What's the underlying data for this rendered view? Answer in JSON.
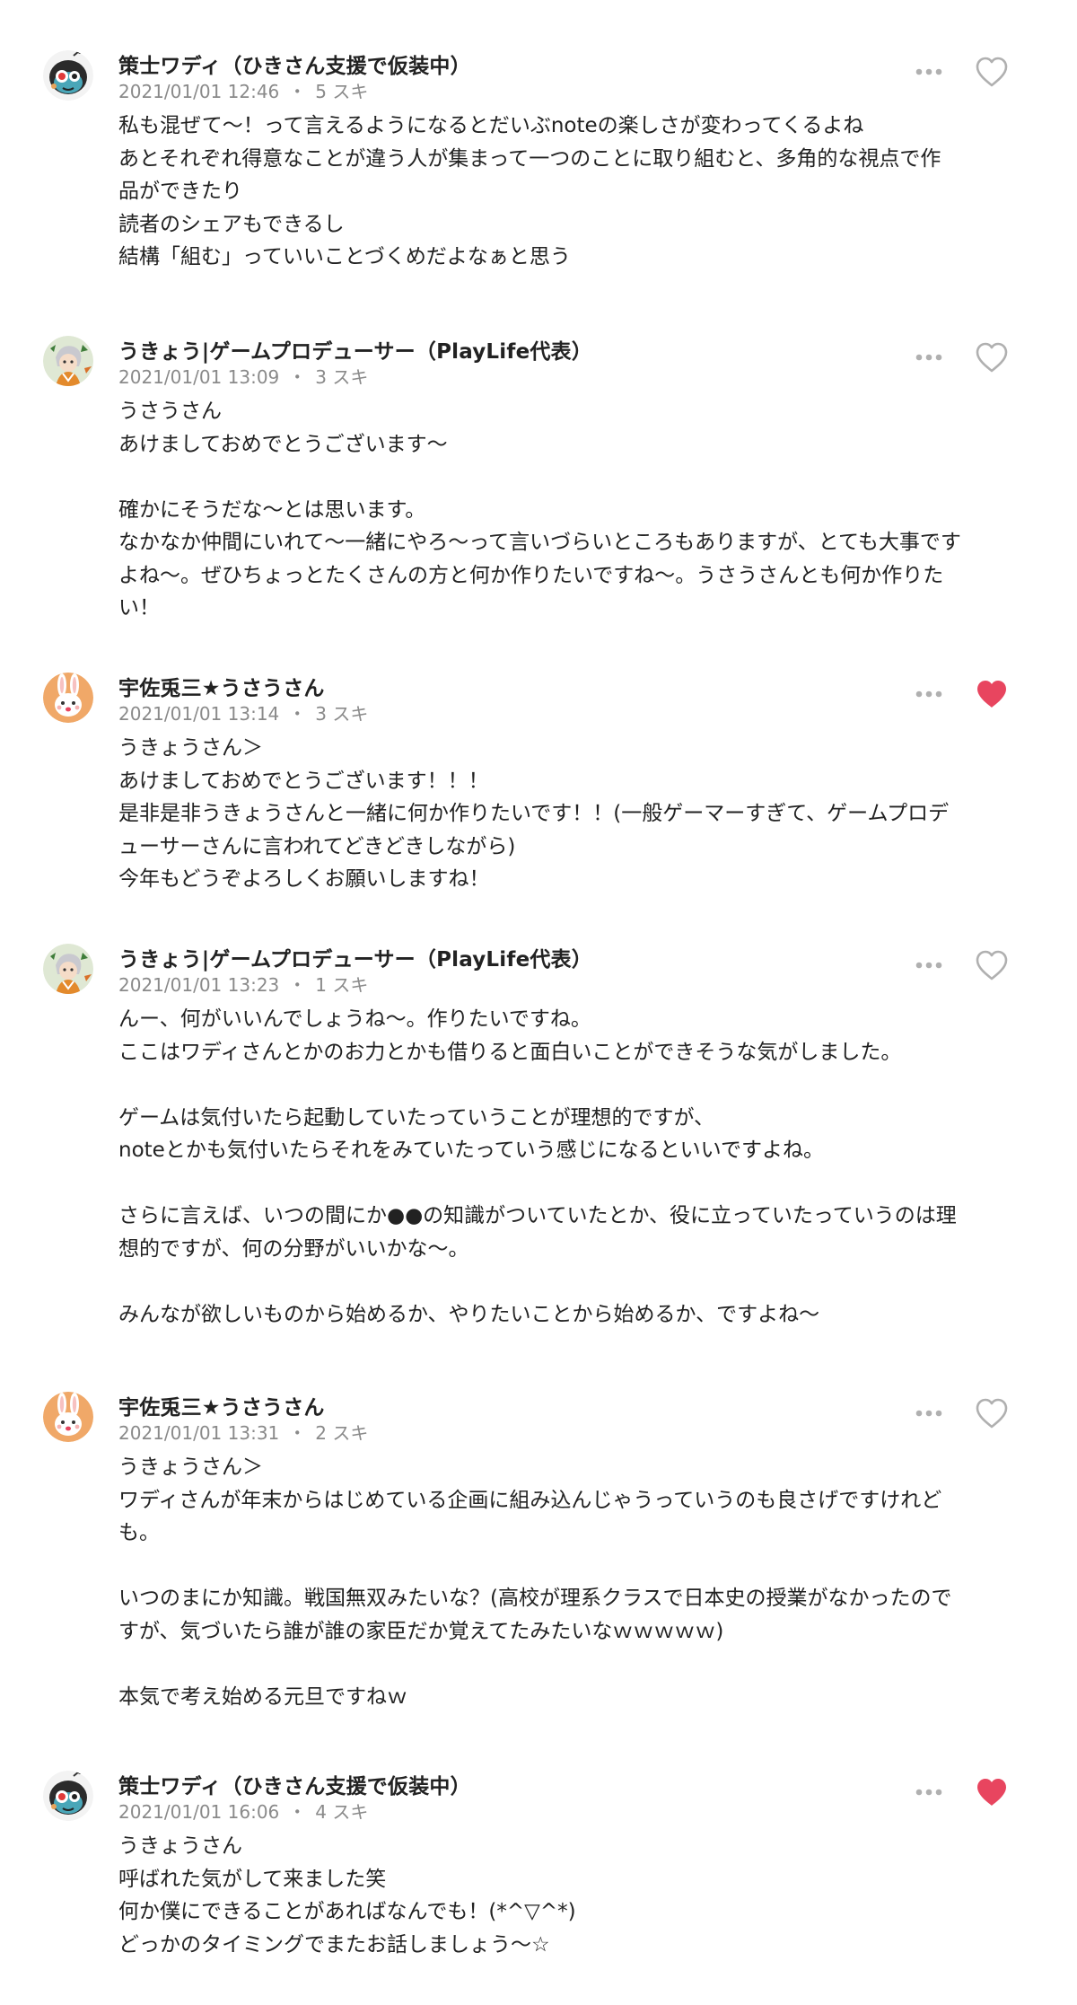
{
  "comments": [
    {
      "author": "策士ワディ（ひきさん支援で仮装中）",
      "date": "2021/01/01 12:46",
      "likes": "5 スキ",
      "liked": false,
      "avatar_icon": "robot-avatar-icon",
      "lines": [
        "私も混ぜて〜！って言えるようになるとだいぶnoteの楽しさが変わってくるよね",
        "あとそれぞれ得意なことが違う人が集まって一つのことに取り組むと、多角的な視点で作",
        "品ができたり",
        "読者のシェアもできるし",
        "結構「組む」っていいことづくめだよなぁと思う"
      ]
    },
    {
      "author": "うきょう|ゲームプロデューサー（PlayLife代表）",
      "date": "2021/01/01 13:09",
      "likes": "3 スキ",
      "liked": false,
      "avatar_icon": "character-avatar-icon",
      "lines": [
        "うさうさん",
        "あけましておめでとうございます〜",
        "",
        "確かにそうだな〜とは思います。",
        "なかなか仲間にいれて〜一緒にやろ〜って言いづらいところもありますが、とても大事です",
        "よね〜。ぜひちょっとたくさんの方と何か作りたいですね〜。うさうさんとも何か作りた",
        "い！"
      ]
    },
    {
      "author": "宇佐兎三★うさうさん",
      "date": "2021/01/01 13:14",
      "likes": "3 スキ",
      "liked": true,
      "avatar_icon": "rabbit-avatar-icon",
      "lines": [
        "うきょうさん＞",
        "あけましておめでとうございます！！！",
        "是非是非うきょうさんと一緒に何か作りたいです！！(一般ゲーマーすぎて、ゲームプロデ",
        "ューサーさんに言われてどきどきしながら)",
        "今年もどうぞよろしくお願いしますね！"
      ]
    },
    {
      "author": "うきょう|ゲームプロデューサー（PlayLife代表）",
      "date": "2021/01/01 13:23",
      "likes": "1 スキ",
      "liked": false,
      "avatar_icon": "character-avatar-icon",
      "lines": [
        "んー、何がいいんでしょうね〜。作りたいですね。",
        "ここはワディさんとかのお力とかも借りると面白いことができそうな気がしました。",
        "",
        "ゲームは気付いたら起動していたっていうことが理想的ですが、",
        "noteとかも気付いたらそれをみていたっていう感じになるといいですよね。",
        "",
        "さらに言えば、いつの間にか●●の知識がついていたとか、役に立っていたっていうのは理",
        "想的ですが、何の分野がいいかな〜。",
        "",
        "みんなが欲しいものから始めるか、やりたいことから始めるか、ですよね〜"
      ]
    },
    {
      "author": "宇佐兎三★うさうさん",
      "date": "2021/01/01 13:31",
      "likes": "2 スキ",
      "liked": false,
      "avatar_icon": "rabbit-avatar-icon",
      "lines": [
        "うきょうさん＞",
        "ワディさんが年末からはじめている企画に組み込んじゃうっていうのも良さげですけれど",
        "も。",
        "",
        "いつのまにか知識。戦国無双みたいな？(高校が理系クラスで日本史の授業がなかったので",
        "すが、気づいたら誰が誰の家臣だか覚えてたみたいなｗｗｗｗｗ)",
        "",
        "本気で考え始める元旦ですねｗ"
      ]
    },
    {
      "author": "策士ワディ（ひきさん支援で仮装中）",
      "date": "2021/01/01 16:06",
      "likes": "4 スキ",
      "liked": true,
      "avatar_icon": "robot-avatar-icon",
      "lines": [
        "うきょうさん",
        "呼ばれた気がして来ました笑",
        "何か僕にできることがあればなんでも！(*^▽^*)",
        "どっかのタイミングでまたお話しましょう〜☆"
      ]
    }
  ],
  "meta_separator": "・",
  "icons": {
    "more": "more-options-icon",
    "like": "heart-icon"
  },
  "colors": {
    "text": "#222222",
    "meta": "#8a8a8a",
    "icon": "#b0b0b0",
    "liked": "#e8455f"
  }
}
